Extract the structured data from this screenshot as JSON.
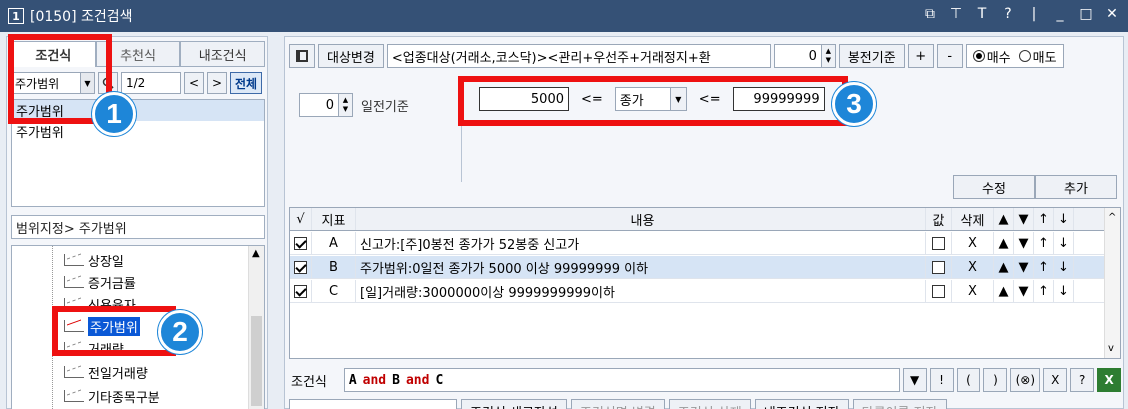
{
  "window": {
    "number": "1",
    "title": "[0150] 조건검색",
    "controls": [
      "⧉",
      "⊤",
      "T",
      "?",
      "|",
      "_",
      "□",
      "✕"
    ]
  },
  "left": {
    "tabs": [
      "조건식",
      "추천식",
      "내조건식"
    ],
    "filter_combo": "주가범위",
    "page": "1/2",
    "prev": "<",
    "next": ">",
    "all_label": "전체",
    "list": [
      "주가범위",
      "주가범위"
    ],
    "range_label": "범위지정> 주가범위",
    "tree": [
      "상장일",
      "증거금률",
      "신용융자",
      "주가범위",
      "거래량",
      "전일거래량",
      "기타종목구분"
    ]
  },
  "right": {
    "target_change": "대상변경",
    "target_text": "<업종대상(거래소,코스닥)><관리+우선주+거래정지+환",
    "bong_value": "0",
    "bong_label": "봉전기준",
    "plus": "+",
    "minus": "-",
    "radio_buy": "매수",
    "radio_sell": "매도",
    "day_value": "0",
    "day_label": "일전기준",
    "min_value": "5000",
    "op1": "<=",
    "field": "종가",
    "op2": "<=",
    "max_value": "99999999",
    "edit_btn": "수정",
    "add_btn": "추가",
    "grid": {
      "headers": [
        "√",
        "지표",
        "내용",
        "값",
        "삭제",
        "▲",
        "▼",
        "↑",
        "↓"
      ],
      "rows": [
        {
          "key": "A",
          "content": "신고가:[주]0봉전 종가가 52봉중 신고가",
          "del": "X"
        },
        {
          "key": "B",
          "content": "주가범위:0일전 종가가 5000 이상 99999999 이하",
          "del": "X"
        },
        {
          "key": "C",
          "content": "[일]거래량:3000000이상 9999999999이하",
          "del": "X"
        }
      ],
      "row_arrows": [
        "▲",
        "▼",
        "↑",
        "↓"
      ]
    },
    "expr_label": "조건식",
    "expr": {
      "a": "A",
      "and1": "and",
      "b": "B",
      "and2": "and",
      "c": "C"
    },
    "expr_btns": [
      "▼",
      "!",
      "(",
      ")",
      "(⊗)",
      "X",
      "?"
    ],
    "bottom_btns": [
      "조건식 새로작성",
      "조건식명 변경",
      "조건식 삭제",
      "내조건식 저장",
      "다른이름 저장"
    ]
  },
  "annotations": [
    "1",
    "2",
    "3"
  ]
}
